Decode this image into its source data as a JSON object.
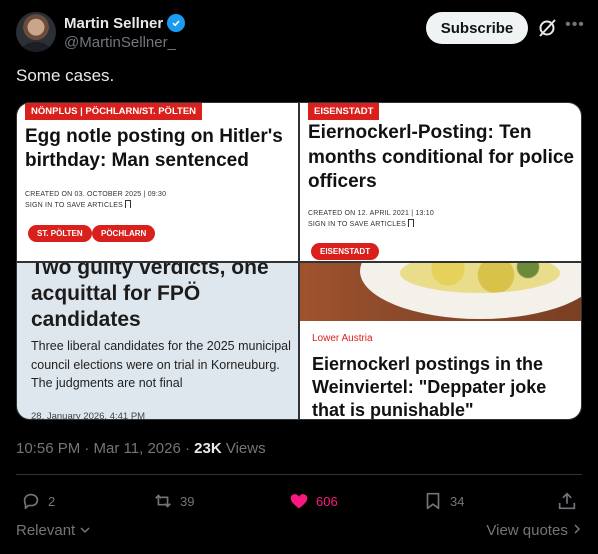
{
  "author": {
    "name": "Martin Sellner",
    "handle": "@MartinSellner_",
    "subscribe_label": "Subscribe"
  },
  "tweet": {
    "text": "Some cases."
  },
  "media": [
    {
      "kicker": "NÖNPLUS | PÖCHLARN/ST. PÖLTEN",
      "headline": "Egg notle posting on Hitler's birthday: Man sentenced",
      "meta_line1": "CREATED ON 03. OCTOBER 2025 | 09:30",
      "meta_line2": "SIGN IN TO SAVE ARTICLES",
      "tags": [
        "ST. PÖLTEN",
        "PÖCHLARN"
      ]
    },
    {
      "kicker": "EISENSTADT",
      "headline": "Eiernockerl-Posting: Ten months conditional for police officers",
      "meta_line1": "CREATED ON 12. APRIL 2021 | 13:10",
      "meta_line2": "SIGN IN TO SAVE ARTICLES",
      "tags": [
        "EISENSTADT"
      ]
    },
    {
      "headline": "Two guilty verdicts, one acquittal for FPÖ candidates",
      "description": "Three liberal candidates for the 2025 municipal council elections were on trial in Korneuburg. The judgments are not final",
      "date": "28. January 2026, 4:41 PM"
    },
    {
      "region": "Lower Austria",
      "headline": "Eiernockerl postings in the Weinviertel: \"Deppater joke that is punishable\""
    }
  ],
  "timestamp": {
    "time_date": "10:56 PM · Mar 11, 2026 · ",
    "views_count": "23K",
    "views_label": " Views"
  },
  "actions": {
    "replies": "2",
    "reposts": "39",
    "likes": "606",
    "bookmarks": "34"
  },
  "footer": {
    "sort_label": "Relevant",
    "quotes_label": "View quotes"
  },
  "colors": {
    "accent_blue": "#1d9bf0",
    "like_pink": "#f91880",
    "kicker_red": "#d9201d"
  },
  "icons": [
    "verified-badge-icon",
    "grok-icon",
    "more-icon",
    "reply-icon",
    "repost-icon",
    "heart-icon",
    "bookmark-icon",
    "share-icon",
    "chevron-down-icon",
    "chevron-right-icon"
  ]
}
